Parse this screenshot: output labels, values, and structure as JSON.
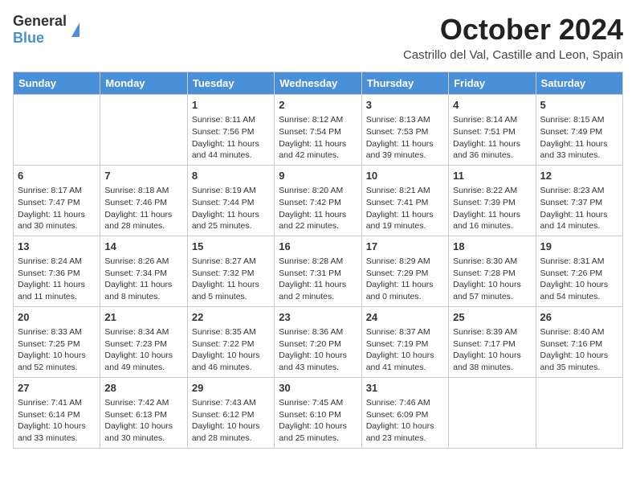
{
  "logo": {
    "general": "General",
    "blue": "Blue"
  },
  "title": "October 2024",
  "location": "Castrillo del Val, Castille and Leon, Spain",
  "headers": [
    "Sunday",
    "Monday",
    "Tuesday",
    "Wednesday",
    "Thursday",
    "Friday",
    "Saturday"
  ],
  "weeks": [
    [
      {
        "day": "",
        "sunrise": "",
        "sunset": "",
        "daylight": ""
      },
      {
        "day": "",
        "sunrise": "",
        "sunset": "",
        "daylight": ""
      },
      {
        "day": "1",
        "sunrise": "Sunrise: 8:11 AM",
        "sunset": "Sunset: 7:56 PM",
        "daylight": "Daylight: 11 hours and 44 minutes."
      },
      {
        "day": "2",
        "sunrise": "Sunrise: 8:12 AM",
        "sunset": "Sunset: 7:54 PM",
        "daylight": "Daylight: 11 hours and 42 minutes."
      },
      {
        "day": "3",
        "sunrise": "Sunrise: 8:13 AM",
        "sunset": "Sunset: 7:53 PM",
        "daylight": "Daylight: 11 hours and 39 minutes."
      },
      {
        "day": "4",
        "sunrise": "Sunrise: 8:14 AM",
        "sunset": "Sunset: 7:51 PM",
        "daylight": "Daylight: 11 hours and 36 minutes."
      },
      {
        "day": "5",
        "sunrise": "Sunrise: 8:15 AM",
        "sunset": "Sunset: 7:49 PM",
        "daylight": "Daylight: 11 hours and 33 minutes."
      }
    ],
    [
      {
        "day": "6",
        "sunrise": "Sunrise: 8:17 AM",
        "sunset": "Sunset: 7:47 PM",
        "daylight": "Daylight: 11 hours and 30 minutes."
      },
      {
        "day": "7",
        "sunrise": "Sunrise: 8:18 AM",
        "sunset": "Sunset: 7:46 PM",
        "daylight": "Daylight: 11 hours and 28 minutes."
      },
      {
        "day": "8",
        "sunrise": "Sunrise: 8:19 AM",
        "sunset": "Sunset: 7:44 PM",
        "daylight": "Daylight: 11 hours and 25 minutes."
      },
      {
        "day": "9",
        "sunrise": "Sunrise: 8:20 AM",
        "sunset": "Sunset: 7:42 PM",
        "daylight": "Daylight: 11 hours and 22 minutes."
      },
      {
        "day": "10",
        "sunrise": "Sunrise: 8:21 AM",
        "sunset": "Sunset: 7:41 PM",
        "daylight": "Daylight: 11 hours and 19 minutes."
      },
      {
        "day": "11",
        "sunrise": "Sunrise: 8:22 AM",
        "sunset": "Sunset: 7:39 PM",
        "daylight": "Daylight: 11 hours and 16 minutes."
      },
      {
        "day": "12",
        "sunrise": "Sunrise: 8:23 AM",
        "sunset": "Sunset: 7:37 PM",
        "daylight": "Daylight: 11 hours and 14 minutes."
      }
    ],
    [
      {
        "day": "13",
        "sunrise": "Sunrise: 8:24 AM",
        "sunset": "Sunset: 7:36 PM",
        "daylight": "Daylight: 11 hours and 11 minutes."
      },
      {
        "day": "14",
        "sunrise": "Sunrise: 8:26 AM",
        "sunset": "Sunset: 7:34 PM",
        "daylight": "Daylight: 11 hours and 8 minutes."
      },
      {
        "day": "15",
        "sunrise": "Sunrise: 8:27 AM",
        "sunset": "Sunset: 7:32 PM",
        "daylight": "Daylight: 11 hours and 5 minutes."
      },
      {
        "day": "16",
        "sunrise": "Sunrise: 8:28 AM",
        "sunset": "Sunset: 7:31 PM",
        "daylight": "Daylight: 11 hours and 2 minutes."
      },
      {
        "day": "17",
        "sunrise": "Sunrise: 8:29 AM",
        "sunset": "Sunset: 7:29 PM",
        "daylight": "Daylight: 11 hours and 0 minutes."
      },
      {
        "day": "18",
        "sunrise": "Sunrise: 8:30 AM",
        "sunset": "Sunset: 7:28 PM",
        "daylight": "Daylight: 10 hours and 57 minutes."
      },
      {
        "day": "19",
        "sunrise": "Sunrise: 8:31 AM",
        "sunset": "Sunset: 7:26 PM",
        "daylight": "Daylight: 10 hours and 54 minutes."
      }
    ],
    [
      {
        "day": "20",
        "sunrise": "Sunrise: 8:33 AM",
        "sunset": "Sunset: 7:25 PM",
        "daylight": "Daylight: 10 hours and 52 minutes."
      },
      {
        "day": "21",
        "sunrise": "Sunrise: 8:34 AM",
        "sunset": "Sunset: 7:23 PM",
        "daylight": "Daylight: 10 hours and 49 minutes."
      },
      {
        "day": "22",
        "sunrise": "Sunrise: 8:35 AM",
        "sunset": "Sunset: 7:22 PM",
        "daylight": "Daylight: 10 hours and 46 minutes."
      },
      {
        "day": "23",
        "sunrise": "Sunrise: 8:36 AM",
        "sunset": "Sunset: 7:20 PM",
        "daylight": "Daylight: 10 hours and 43 minutes."
      },
      {
        "day": "24",
        "sunrise": "Sunrise: 8:37 AM",
        "sunset": "Sunset: 7:19 PM",
        "daylight": "Daylight: 10 hours and 41 minutes."
      },
      {
        "day": "25",
        "sunrise": "Sunrise: 8:39 AM",
        "sunset": "Sunset: 7:17 PM",
        "daylight": "Daylight: 10 hours and 38 minutes."
      },
      {
        "day": "26",
        "sunrise": "Sunrise: 8:40 AM",
        "sunset": "Sunset: 7:16 PM",
        "daylight": "Daylight: 10 hours and 35 minutes."
      }
    ],
    [
      {
        "day": "27",
        "sunrise": "Sunrise: 7:41 AM",
        "sunset": "Sunset: 6:14 PM",
        "daylight": "Daylight: 10 hours and 33 minutes."
      },
      {
        "day": "28",
        "sunrise": "Sunrise: 7:42 AM",
        "sunset": "Sunset: 6:13 PM",
        "daylight": "Daylight: 10 hours and 30 minutes."
      },
      {
        "day": "29",
        "sunrise": "Sunrise: 7:43 AM",
        "sunset": "Sunset: 6:12 PM",
        "daylight": "Daylight: 10 hours and 28 minutes."
      },
      {
        "day": "30",
        "sunrise": "Sunrise: 7:45 AM",
        "sunset": "Sunset: 6:10 PM",
        "daylight": "Daylight: 10 hours and 25 minutes."
      },
      {
        "day": "31",
        "sunrise": "Sunrise: 7:46 AM",
        "sunset": "Sunset: 6:09 PM",
        "daylight": "Daylight: 10 hours and 23 minutes."
      },
      {
        "day": "",
        "sunrise": "",
        "sunset": "",
        "daylight": ""
      },
      {
        "day": "",
        "sunrise": "",
        "sunset": "",
        "daylight": ""
      }
    ]
  ]
}
